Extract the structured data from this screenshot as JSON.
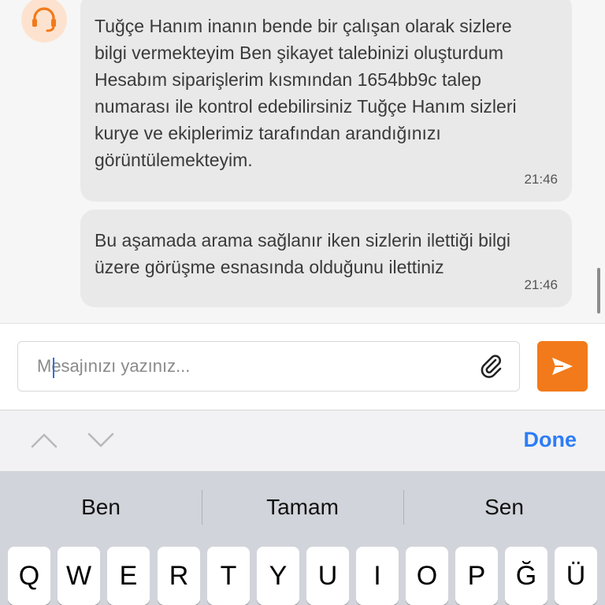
{
  "chat": {
    "avatar_icon": "headset-icon",
    "messages": [
      {
        "text": "Tuğçe Hanım inanın bende bir çalışan olarak sizlere bilgi vermekteyim Ben şikayet talebinizi oluşturdum Hesabım siparişlerim kısmından 1654bb9c talep numarası ile kontrol edebilirsiniz Tuğçe Hanım sizleri kurye ve ekiplerimiz tarafından arandığınızı görüntülemekteyim.",
        "time": "21:46"
      },
      {
        "text": "Bu aşamada arama sağlanır iken sizlerin ilettiği bilgi üzere görüşme esnasında olduğunu ilettiniz",
        "time": "21:46"
      }
    ]
  },
  "composer": {
    "placeholder": "Mesajınızı yazınız...",
    "value": "",
    "attach_icon": "paperclip-icon",
    "send_icon": "send-arrow-icon",
    "accent_color": "#f27a1a"
  },
  "accessory": {
    "prev_icon": "chevron-up-icon",
    "next_icon": "chevron-down-icon",
    "done_label": "Done"
  },
  "suggestions": [
    "Ben",
    "Tamam",
    "Sen"
  ],
  "keyboard": {
    "row1": [
      "Q",
      "W",
      "E",
      "R",
      "T",
      "Y",
      "U",
      "I",
      "O",
      "P",
      "Ğ",
      "Ü"
    ]
  }
}
